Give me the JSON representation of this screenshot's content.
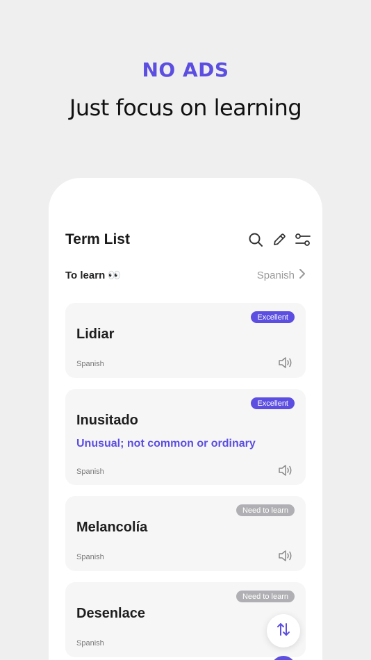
{
  "promo": {
    "headline": "NO ADS",
    "tagline": "Just focus on learning"
  },
  "header": {
    "title": "Term List",
    "icons": [
      "search-icon",
      "edit-pencil-icon",
      "filter-sliders-icon"
    ]
  },
  "filter": {
    "label": "To learn 👀",
    "language": "Spanish"
  },
  "colors": {
    "accent": "#5b4ee0",
    "badge_need": "#b0b0b4",
    "card_bg": "#f6f6f7"
  },
  "cards": [
    {
      "term": "Lidiar",
      "meaning": "",
      "language": "Spanish",
      "status": "Excellent"
    },
    {
      "term": "Inusitado",
      "meaning": "Unusual; not common or ordinary",
      "language": "Spanish",
      "status": "Excellent"
    },
    {
      "term": "Melancolía",
      "meaning": "",
      "language": "Spanish",
      "status": "Need to learn"
    },
    {
      "term": "Desenlace",
      "meaning": "",
      "language": "Spanish",
      "status": "Need to learn"
    }
  ]
}
